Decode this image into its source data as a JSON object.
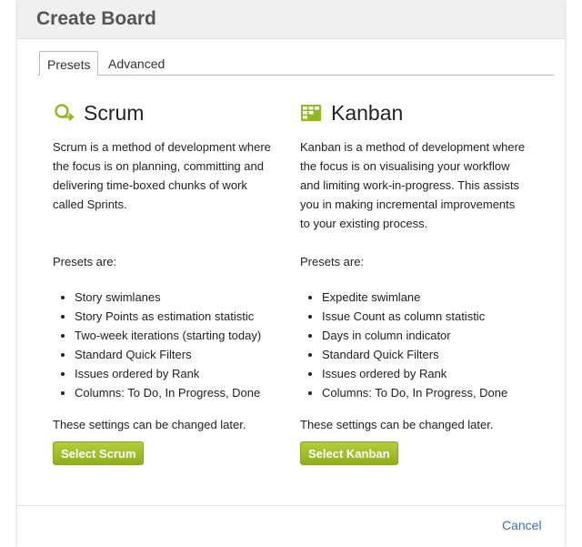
{
  "dialog": {
    "title": "Create Board",
    "cancel_label": "Cancel"
  },
  "tabs": [
    {
      "label": "Presets",
      "active": true
    },
    {
      "label": "Advanced",
      "active": false
    }
  ],
  "scrum": {
    "icon": "scrum-cycle-icon",
    "title": "Scrum",
    "description": "Scrum is a method of development where the focus is on planning, committing and delivering time-boxed chunks of work called Sprints.",
    "presets_label": "Presets are:",
    "presets": [
      "Story swimlanes",
      "Story Points as estimation statistic",
      "Two-week iterations (starting today)",
      "Standard Quick Filters",
      "Issues ordered by Rank",
      "Columns: To Do, In Progress, Done"
    ],
    "note": "These settings can be changed later.",
    "button_label": "Select Scrum"
  },
  "kanban": {
    "icon": "kanban-board-icon",
    "title": "Kanban",
    "description": "Kanban is a method of development where the focus is on visualising your workflow and limiting work-in-progress. This assists you in making incremental improvements to your existing process.",
    "presets_label": "Presets are:",
    "presets": [
      "Expedite swimlane",
      "Issue Count as column statistic",
      "Days in column indicator",
      "Standard Quick Filters",
      "Issues ordered by Rank",
      "Columns: To Do, In Progress, Done"
    ],
    "note": "These settings can be changed later.",
    "button_label": "Select Kanban"
  },
  "colors": {
    "accent_green": "#9cbe28",
    "link_blue": "#3b73af",
    "header_bg": "#f0f0f0"
  }
}
